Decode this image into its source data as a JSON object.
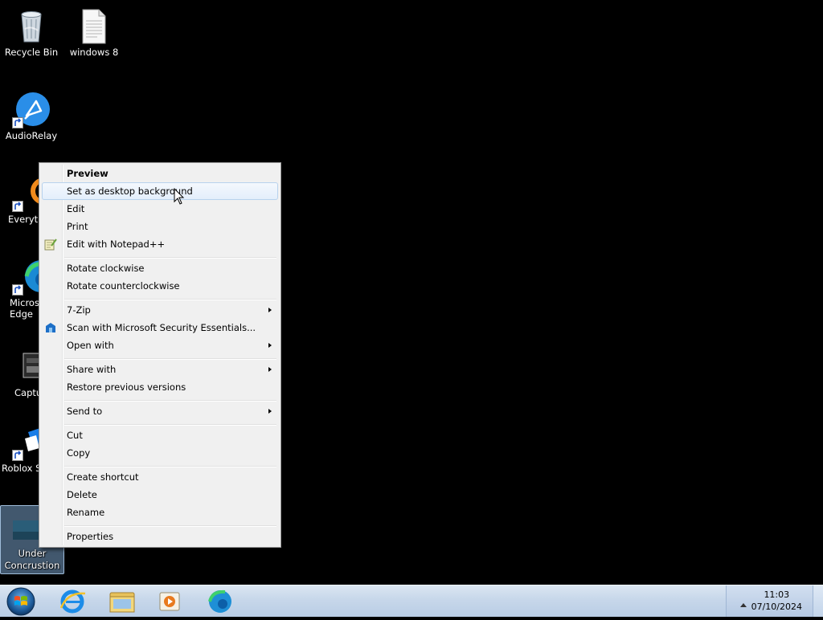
{
  "desktop": {
    "icons": [
      {
        "label": "Recycle Bin"
      },
      {
        "label": "windows 8"
      },
      {
        "label": "AudioRelay"
      },
      {
        "label": "Everyth"
      },
      {
        "label": "Micros Edge"
      },
      {
        "label": "Captu"
      },
      {
        "label": "Roblox S"
      },
      {
        "label": "Under Concrustion"
      }
    ]
  },
  "context_menu": {
    "items": {
      "preview": "Preview",
      "set_background": "Set as desktop background",
      "edit": "Edit",
      "print": "Print",
      "edit_notepad": "Edit with Notepad++",
      "rotate_cw": "Rotate clockwise",
      "rotate_ccw": "Rotate counterclockwise",
      "seven_zip": "7-Zip",
      "scan_mse": "Scan with Microsoft Security Essentials...",
      "open_with": "Open with",
      "share_with": "Share with",
      "restore_versions": "Restore previous versions",
      "send_to": "Send to",
      "cut": "Cut",
      "copy": "Copy",
      "create_shortcut": "Create shortcut",
      "delete": "Delete",
      "rename": "Rename",
      "properties": "Properties"
    }
  },
  "taskbar": {
    "pinned": [
      "internet-explorer-icon",
      "file-explorer-icon",
      "media-player-icon",
      "edge-icon"
    ],
    "clock": {
      "time": "11:03",
      "date": "07/10/2024"
    }
  },
  "colors": {
    "menu_bg": "#f0f0f0",
    "menu_hover": "#e3eefb",
    "taskbar": "#c7d7ea"
  }
}
